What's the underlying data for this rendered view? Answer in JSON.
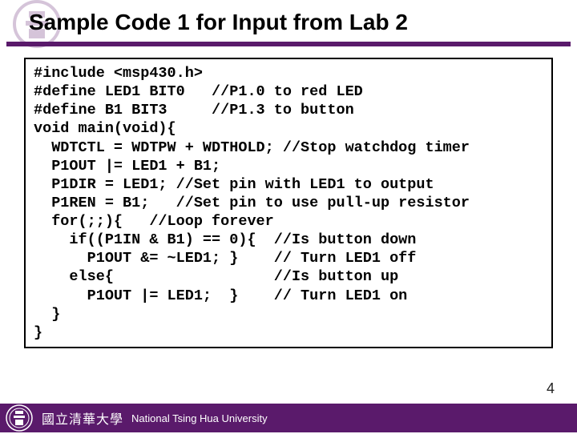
{
  "title": "Sample Code 1 for Input from Lab 2",
  "code": "#include <msp430.h>\n#define LED1 BIT0   //P1.0 to red LED\n#define B1 BIT3     //P1.3 to button\nvoid main(void){\n  WDTCTL = WDTPW + WDTHOLD; //Stop watchdog timer\n  P1OUT |= LED1 + B1;\n  P1DIR = LED1; //Set pin with LED1 to output\n  P1REN = B1;   //Set pin to use pull-up resistor\n  for(;;){   //Loop forever\n    if((P1IN & B1) == 0){  //Is button down\n      P1OUT &= ~LED1; }    // Turn LED1 off\n    else{                  //Is button up\n      P1OUT |= LED1;  }    // Turn LED1 on\n  }\n}",
  "footer": {
    "cn": "國立清華大學",
    "en": "National Tsing Hua University"
  },
  "page_number": "4"
}
